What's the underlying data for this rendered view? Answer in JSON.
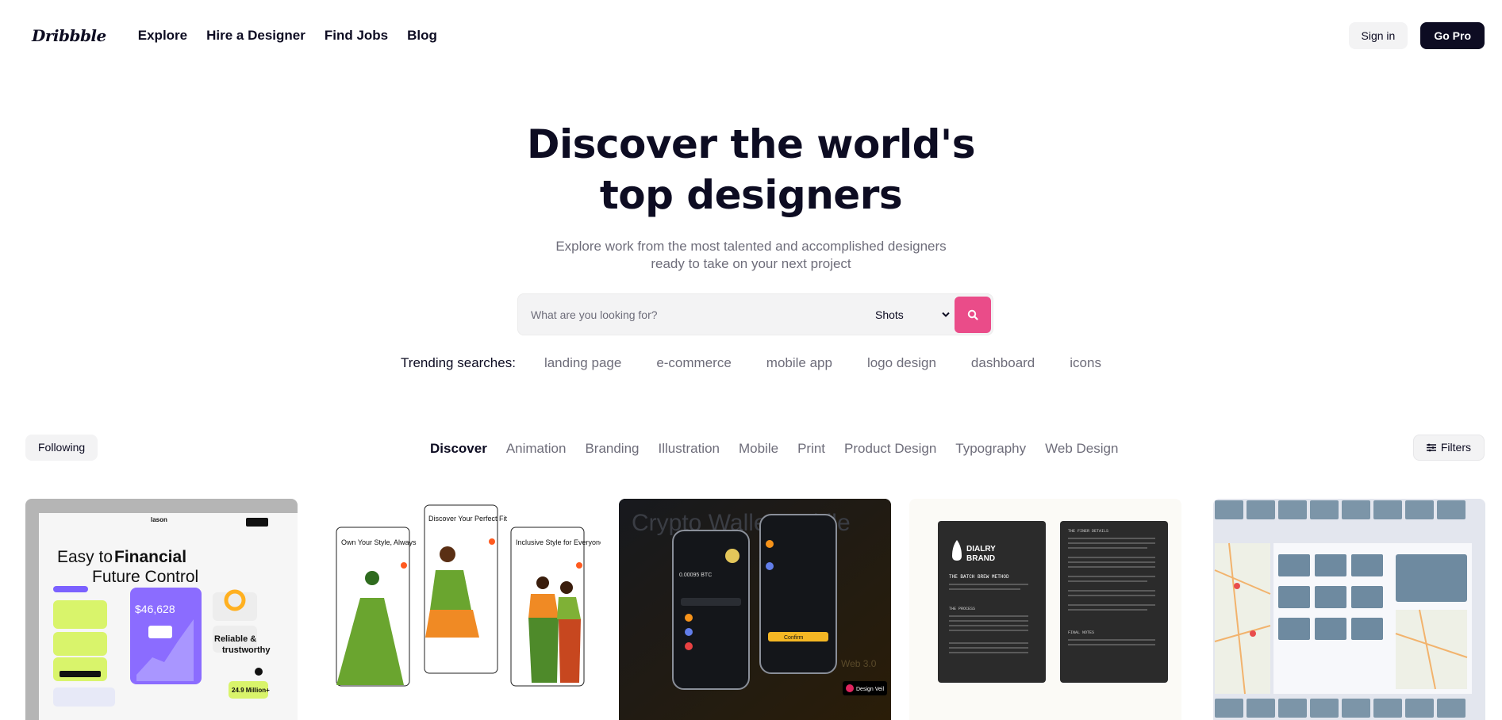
{
  "header": {
    "logo": "Dribbble",
    "nav": [
      "Explore",
      "Hire a Designer",
      "Find Jobs",
      "Blog"
    ],
    "sign_in": "Sign in",
    "go_pro": "Go Pro"
  },
  "hero": {
    "title_line1": "Discover the world's",
    "title_line2": "top designers",
    "subtitle_line1": "Explore work from the most talented and accomplished designers",
    "subtitle_line2": "ready to take on your next project"
  },
  "search": {
    "placeholder": "What are you looking for?",
    "type_selected": "Shots"
  },
  "trending": {
    "label": "Trending searches:",
    "terms": [
      "landing page",
      "e-commerce",
      "mobile app",
      "logo design",
      "dashboard",
      "icons"
    ]
  },
  "filters_row": {
    "following": "Following",
    "categories": [
      "Discover",
      "Animation",
      "Branding",
      "Illustration",
      "Mobile",
      "Print",
      "Product Design",
      "Typography",
      "Web Design"
    ],
    "active_category": "Discover",
    "filters": "Filters"
  },
  "shots": {
    "s1": {
      "brand": "lason",
      "headline_a": "Easy to",
      "headline_b": "Financial",
      "headline_c": "Future Control",
      "balance": "$46,628",
      "reliable": "Reliable &",
      "trust": "trustworthy",
      "users": "24.9 Million+"
    },
    "s2": {
      "card1": "Own Your Style, Always",
      "card2": "Discover Your Perfect Fit",
      "card3": "Inclusive Style for Everyone"
    },
    "s3": {
      "bg_text": "Crypto Wallet Mobile",
      "web": "Web 3.0",
      "badge": "Design Veil",
      "confirm": "Confirm",
      "btc": "0.00095 BTC"
    },
    "s4": {
      "brand_a": "DIALRY",
      "brand_b": "BRAND",
      "method": "THE BATCH BREW METHOD",
      "details": "THE FINER DETAILS",
      "process": "THE PROCESS",
      "notes": "FINAL NOTES"
    }
  },
  "colors": {
    "accent": "#ea4c89",
    "text": "#0d0c22",
    "muted": "#6e6d7a",
    "chip": "#f3f3f4"
  }
}
